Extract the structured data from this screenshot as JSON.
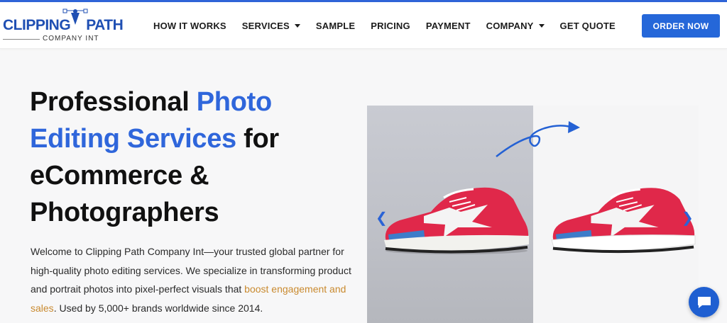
{
  "brand": {
    "name": "CLIPPINGPATH",
    "name_left": "CLIPPING",
    "name_right": "PATH",
    "tagline": "COMPANY INT"
  },
  "nav": {
    "how_it_works": "HOW IT WORKS",
    "services": "SERVICES",
    "sample": "SAMPLE",
    "pricing": "PRICING",
    "payment": "PAYMENT",
    "company": "COMPANY",
    "get_quote": "GET QUOTE"
  },
  "order_button": "ORDER NOW",
  "hero": {
    "title_part1": "Professional ",
    "title_highlight": "Photo Editing Services",
    "title_part2": " for eCommerce & Photographers",
    "intro_part1": "Welcome to Clipping Path Company Int—your trusted global partner for high-quality photo editing services. We specialize in transforming product and portrait photos into pixel-perfect visuals that ",
    "intro_highlight": "boost engagement and sales",
    "intro_part2": ". Used by 5,000+ brands worldwide since 2014."
  },
  "showcase": {
    "prev_arrow": "❮",
    "next_arrow": "❯"
  },
  "colors": {
    "accent": "#2567d9",
    "highlight_blue": "#2f66db",
    "highlight_orange": "#c98a2f"
  }
}
